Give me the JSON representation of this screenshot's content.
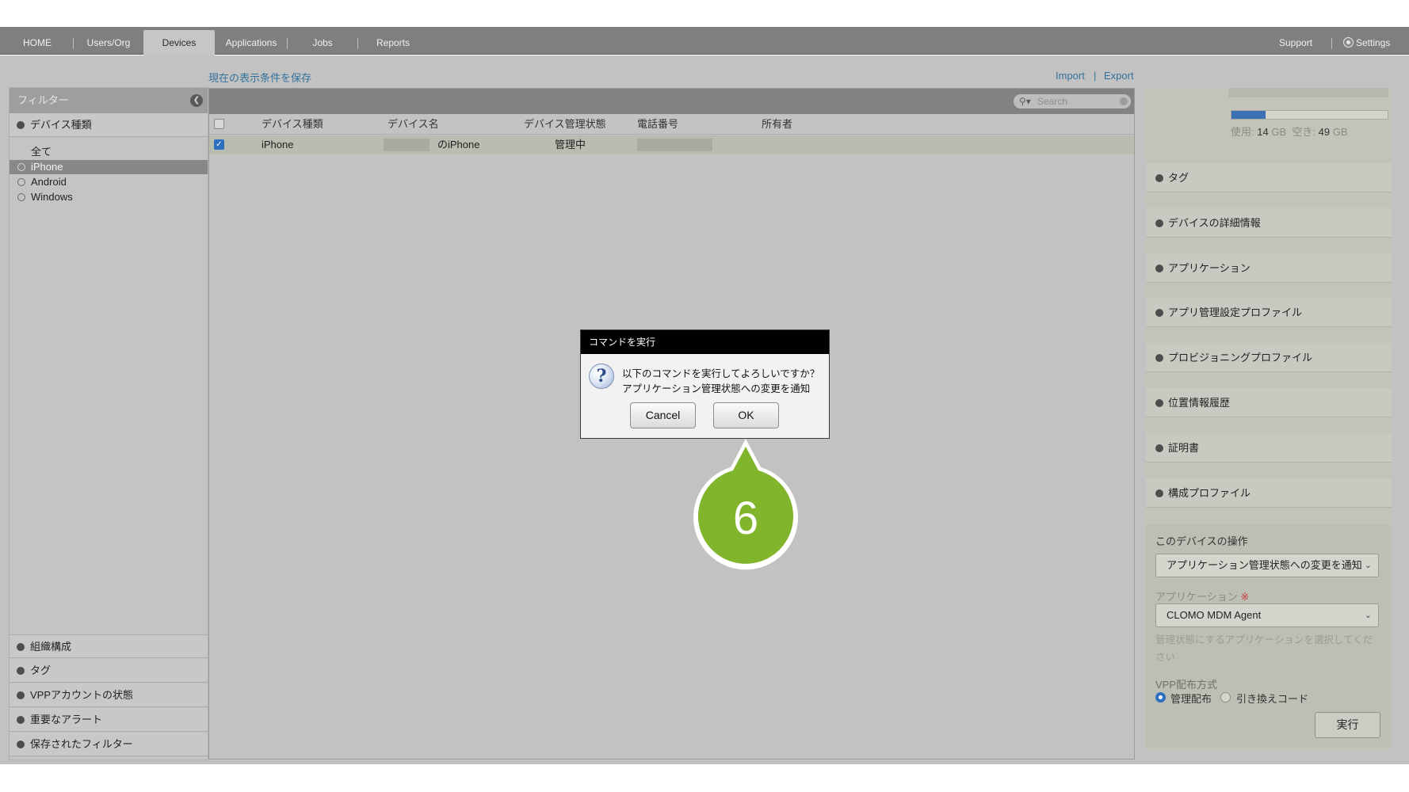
{
  "nav": {
    "tabs": [
      {
        "label": "HOME"
      },
      {
        "label": "Users/Org"
      },
      {
        "label": "Devices"
      },
      {
        "label": "Applications"
      },
      {
        "label": "Jobs"
      },
      {
        "label": "Reports"
      }
    ],
    "active_tab": "Devices",
    "support_label": "Support",
    "settings_label": "Settings"
  },
  "toolbar": {
    "save_view_label": "現在の表示条件を保存",
    "import_label": "Import",
    "export_label": "Export",
    "separator": "|"
  },
  "filter": {
    "header": "フィルター",
    "device_type_section": "デバイス種類",
    "items": [
      {
        "label": "全て"
      },
      {
        "label": "iPhone",
        "selected": true
      },
      {
        "label": "Android"
      },
      {
        "label": "Windows"
      }
    ],
    "bottom_sections": [
      {
        "label": "組織構成"
      },
      {
        "label": "タグ"
      },
      {
        "label": "VPPアカウントの状態"
      },
      {
        "label": "重要なアラート"
      },
      {
        "label": "保存されたフィルター"
      }
    ]
  },
  "grid": {
    "search_placeholder": "Search",
    "columns": [
      "デバイス種類",
      "デバイス名",
      "デバイス管理状態",
      "電話番号",
      "所有者"
    ],
    "rows": [
      {
        "checked": true,
        "device_type": "iPhone",
        "device_name": "のiPhone",
        "status": "管理中",
        "phone": "",
        "owner": ""
      }
    ]
  },
  "right": {
    "storage": {
      "used_label": "使用:",
      "used_value": "14",
      "used_unit": "GB",
      "free_label": "空き:",
      "free_value": "49",
      "free_unit": "GB",
      "used_fraction": 0.22
    },
    "sections": [
      {
        "label": "タグ"
      },
      {
        "label": "デバイスの詳細情報"
      },
      {
        "label": "アプリケーション"
      },
      {
        "label": "アプリ管理設定プロファイル"
      },
      {
        "label": "プロビジョニングプロファイル"
      },
      {
        "label": "位置情報履歴"
      },
      {
        "label": "証明書"
      },
      {
        "label": "構成プロファイル"
      }
    ],
    "ops": {
      "title": "このデバイスの操作",
      "command_value": "アプリケーション管理状態への変更を通知",
      "app_label": "アプリケーション",
      "required_mark": "※",
      "app_value": "CLOMO MDM Agent",
      "app_hint_line1": "管理状態にするアプリケーションを選択してくだ",
      "app_hint_line2": "さい",
      "vpp_label": "VPP配布方式",
      "vpp_option_managed": "管理配布",
      "vpp_option_redeem": "引き換えコード",
      "execute_label": "実行"
    }
  },
  "dialog": {
    "title": "コマンドを実行",
    "message_line1": "以下のコマンドを実行してよろしいですか？",
    "message_line2": "アプリケーション管理状態への変更を通知",
    "cancel_label": "Cancel",
    "ok_label": "OK"
  },
  "callout": {
    "step_number": "6",
    "color": "#80b52c"
  }
}
